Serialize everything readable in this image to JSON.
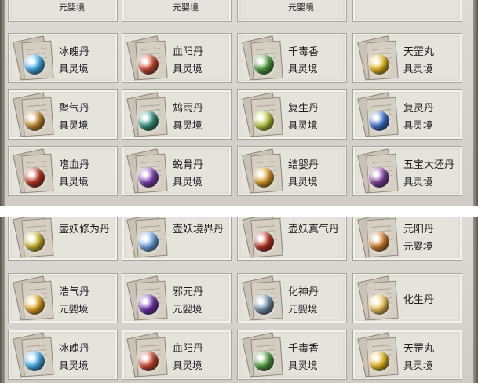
{
  "top_panel": {
    "partial_row_labels": [
      "元婴境",
      "元婴境",
      "元婴境"
    ],
    "items": [
      {
        "name": "冰魄丹",
        "realm": "具灵境",
        "icon": "ice-soul-pill-icon",
        "color": "#3fa8e6"
      },
      {
        "name": "血阳丹",
        "realm": "具灵境",
        "icon": "blood-sun-pill-icon",
        "color": "#c8452c"
      },
      {
        "name": "千毒香",
        "realm": "具灵境",
        "icon": "thousand-poison-incense-icon",
        "color": "#4f9a3a"
      },
      {
        "name": "天罡丸",
        "realm": "具灵境",
        "icon": "heavenly-pill-icon",
        "color": "#e2b51e"
      },
      {
        "name": "聚气丹",
        "realm": "具灵境",
        "icon": "qi-gathering-pill-icon",
        "color": "#c0892a"
      },
      {
        "name": "鸩雨丹",
        "realm": "具灵境",
        "icon": "poison-rain-pill-icon",
        "color": "#2f8f7a"
      },
      {
        "name": "复生丹",
        "realm": "具灵境",
        "icon": "rebirth-pill-icon",
        "color": "#b5c43a"
      },
      {
        "name": "复灵丹",
        "realm": "具灵境",
        "icon": "spirit-restore-pill-icon",
        "color": "#3b6fc8"
      },
      {
        "name": "嗜血丹",
        "realm": "具灵境",
        "icon": "bloodthirst-pill-icon",
        "color": "#b8321f"
      },
      {
        "name": "蜕骨丹",
        "realm": "具灵境",
        "icon": "bone-shedding-pill-icon",
        "color": "#7a3fb0"
      },
      {
        "name": "结婴丹",
        "realm": "具灵境",
        "icon": "nascent-soul-pill-icon",
        "color": "#d69a1e"
      },
      {
        "name": "五宝大还丹",
        "realm": "具灵境",
        "icon": "five-treasure-pill-icon",
        "color": "#7d3a9c"
      }
    ]
  },
  "bottom_panel": {
    "items": [
      {
        "name": "壶妖修为丹",
        "realm": "",
        "icon": "gourd-demon-cultivation-pill-icon",
        "color": "#c9b22a"
      },
      {
        "name": "壶妖境界丹",
        "realm": "",
        "icon": "gourd-demon-realm-pill-icon",
        "color": "#6fa4e0"
      },
      {
        "name": "壶妖真气丹",
        "realm": "",
        "icon": "gourd-demon-true-qi-pill-icon",
        "color": "#b8321f"
      },
      {
        "name": "元阳丹",
        "realm": "元婴境",
        "icon": "primordial-yang-pill-icon",
        "color": "#d07a2a"
      },
      {
        "name": "浩气丹",
        "realm": "元婴境",
        "icon": "vast-qi-pill-icon",
        "color": "#e0a21e"
      },
      {
        "name": "邪元丹",
        "realm": "元婴境",
        "icon": "evil-origin-pill-icon",
        "color": "#6a2fa8"
      },
      {
        "name": "化神丹",
        "realm": "元婴境",
        "icon": "spirit-transform-pill-icon",
        "color": "#6f8fa8"
      },
      {
        "name": "化生丹",
        "realm": "",
        "icon": "transformation-pill-icon",
        "color": "#f0c25a"
      },
      {
        "name": "冰魄丹",
        "realm": "具灵境",
        "icon": "ice-soul-pill-icon",
        "color": "#3fa8e6"
      },
      {
        "name": "血阳丹",
        "realm": "具灵境",
        "icon": "blood-sun-pill-icon",
        "color": "#c8452c"
      },
      {
        "name": "千毒香",
        "realm": "具灵境",
        "icon": "thousand-poison-incense-icon",
        "color": "#4f9a3a"
      },
      {
        "name": "天罡丸",
        "realm": "具灵境",
        "icon": "heavenly-pill-icon",
        "color": "#e2b51e"
      }
    ]
  }
}
